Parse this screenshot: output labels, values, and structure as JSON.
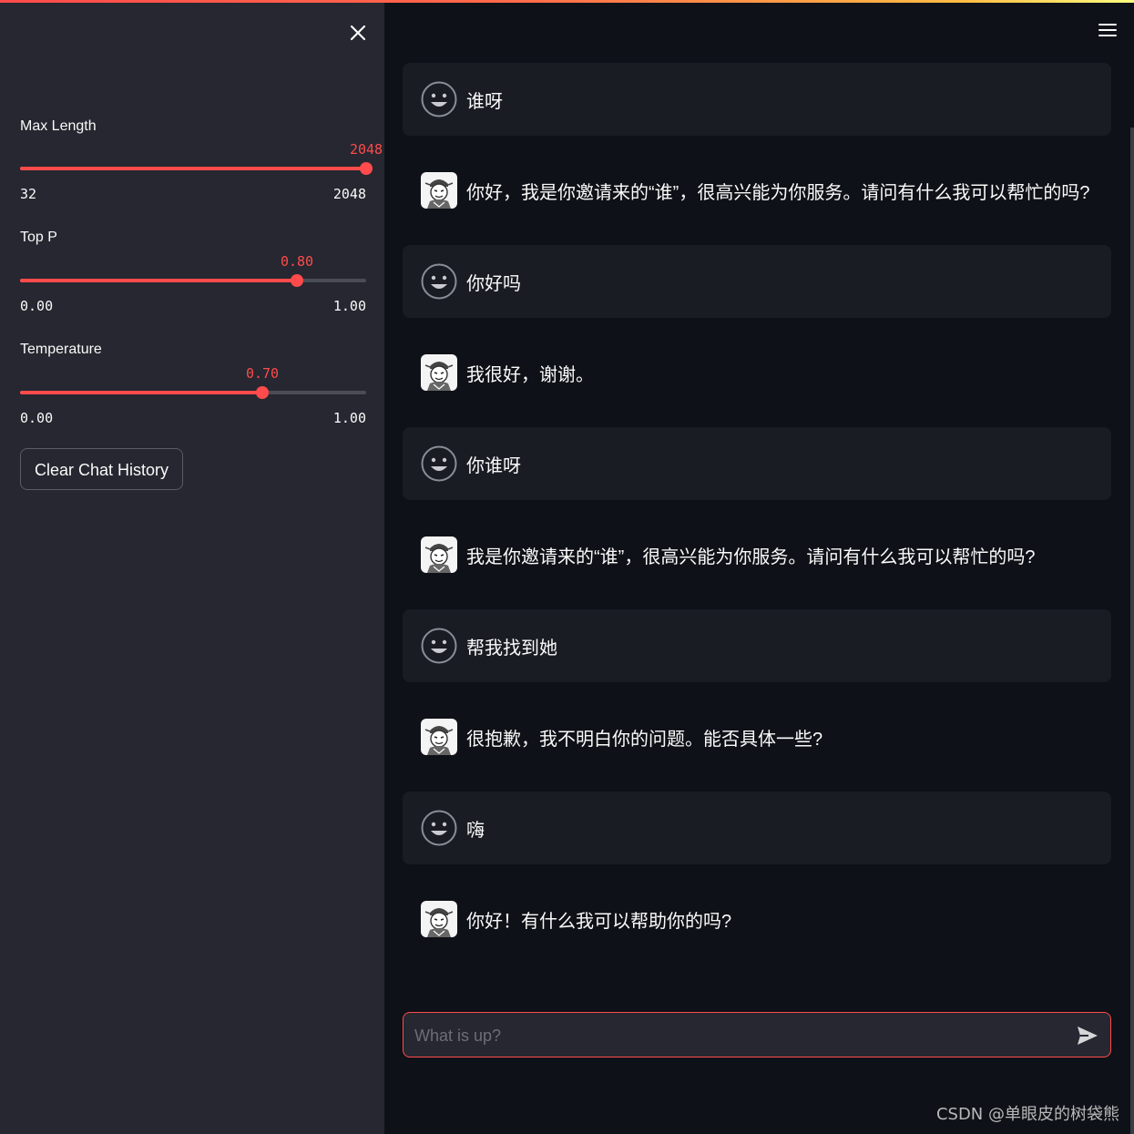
{
  "sidebar": {
    "sliders": [
      {
        "label": "Max Length",
        "value_text": "2048",
        "value": 2048,
        "min": 32,
        "max": 2048,
        "min_text": "32",
        "max_text": "2048"
      },
      {
        "label": "Top P",
        "value_text": "0.80",
        "value": 0.8,
        "min": 0,
        "max": 1,
        "min_text": "0.00",
        "max_text": "1.00"
      },
      {
        "label": "Temperature",
        "value_text": "0.70",
        "value": 0.7,
        "min": 0,
        "max": 1,
        "min_text": "0.00",
        "max_text": "1.00"
      }
    ],
    "clear_button_label": "Clear Chat History"
  },
  "chat": {
    "messages": [
      {
        "role": "user",
        "text": "谁呀"
      },
      {
        "role": "assistant",
        "text": "你好，我是你邀请来的“谁”，很高兴能为你服务。请问有什么我可以帮忙的吗?"
      },
      {
        "role": "user",
        "text": "你好吗"
      },
      {
        "role": "assistant",
        "text": "我很好，谢谢。"
      },
      {
        "role": "user",
        "text": "你谁呀"
      },
      {
        "role": "assistant",
        "text": "我是你邀请来的“谁”，很高兴能为你服务。请问有什么我可以帮忙的吗?"
      },
      {
        "role": "user",
        "text": "帮我找到她"
      },
      {
        "role": "assistant",
        "text": "很抱歉，我不明白你的问题。能否具体一些?"
      },
      {
        "role": "user",
        "text": "嗨"
      },
      {
        "role": "assistant",
        "text": "你好！有什么我可以帮助你的吗?"
      }
    ],
    "input_placeholder": "What is up?"
  },
  "watermark": "CSDN @单眼皮的树袋熊",
  "colors": {
    "accent": "#ff4b4b",
    "sidebar_bg": "#262730",
    "main_bg": "#0e1117",
    "user_msg_bg": "#1a1c24"
  },
  "icons": [
    "close-icon",
    "hamburger-menu-icon",
    "user-avatar-icon",
    "assistant-avatar-icon",
    "send-icon"
  ]
}
